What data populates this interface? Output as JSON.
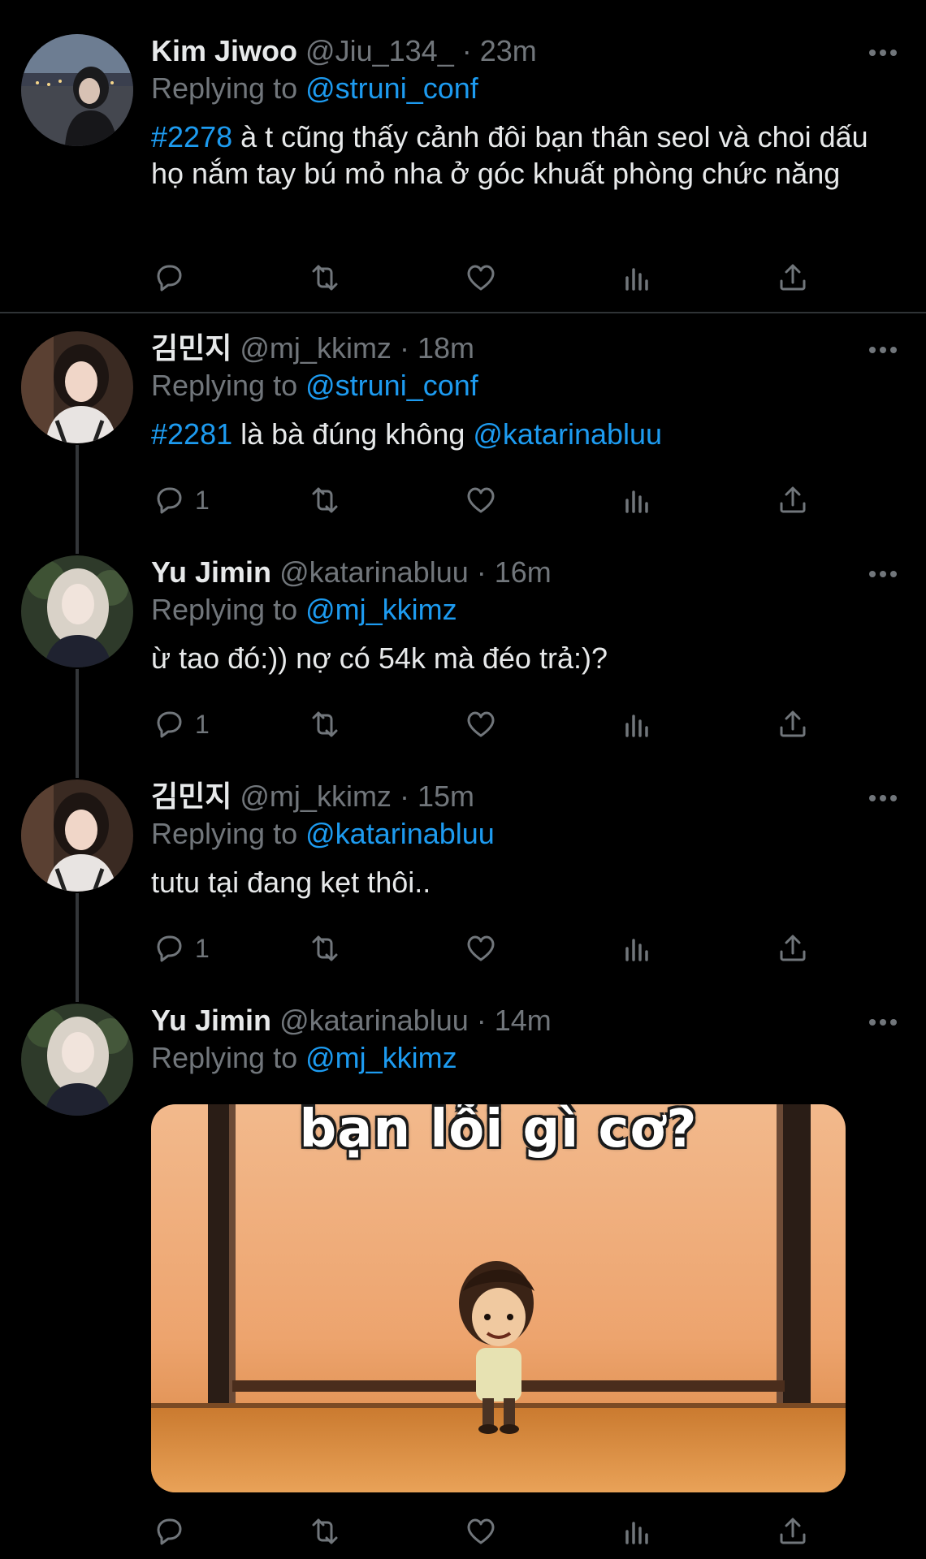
{
  "tweets": [
    {
      "name": "Kim Jiwoo",
      "handle": "@Jiu_134_",
      "time": "· 23m",
      "replying_label": "Replying to",
      "replying_to": "@struni_conf",
      "hashtag": "#2278",
      "text": "à t cũng thấy cảnh đôi bạn thân seol và choi dấu họ nắm tay bú mỏ nha ở góc khuất phòng chức năng",
      "mention": "",
      "reply_count": ""
    },
    {
      "name": "김민지",
      "handle": "@mj_kkimz",
      "time": "· 18m",
      "replying_label": "Replying to",
      "replying_to": "@struni_conf",
      "hashtag": "#2281",
      "text": "là bà đúng không",
      "mention": "@katarinabluu",
      "reply_count": "1"
    },
    {
      "name": "Yu Jimin",
      "handle": "@katarinabluu",
      "time": "· 16m",
      "replying_label": "Replying to",
      "replying_to": "@mj_kkimz",
      "hashtag": "",
      "text": "ừ tao đó:)) nợ có 54k mà đéo trả:)?",
      "mention": "",
      "reply_count": "1"
    },
    {
      "name": "김민지",
      "handle": "@mj_kkimz",
      "time": "· 15m",
      "replying_label": "Replying to",
      "replying_to": "@katarinabluu",
      "hashtag": "",
      "text": "tutu tại đang kẹt thôi..",
      "mention": "",
      "reply_count": "1"
    },
    {
      "name": "Yu Jimin",
      "handle": "@katarinabluu",
      "time": "· 14m",
      "replying_label": "Replying to",
      "replying_to": "@mj_kkimz",
      "hashtag": "",
      "text": "",
      "mention": "",
      "reply_count": "",
      "media_caption": "bạn lỗi gì cơ?"
    }
  ],
  "icons": {
    "reply": "reply-icon",
    "retweet": "retweet-icon",
    "like": "heart-icon",
    "stats": "stats-icon",
    "share": "share-icon",
    "more": "more-icon"
  },
  "colors": {
    "background": "#000000",
    "text": "#e7e9ea",
    "muted": "#71767b",
    "link": "#1d9bf0",
    "divider": "#2f3336"
  }
}
